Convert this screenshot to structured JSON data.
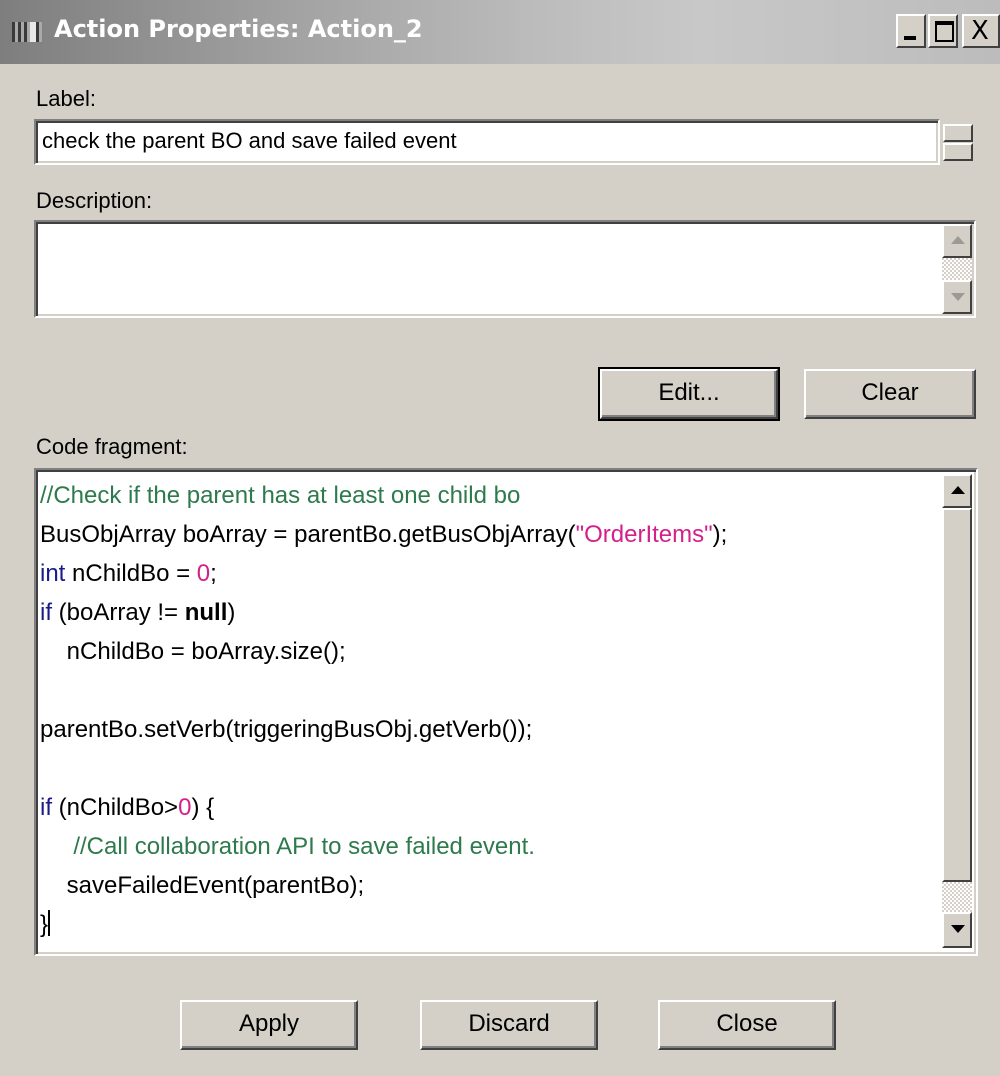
{
  "window": {
    "title": "Action Properties: Action_2",
    "controls": {
      "minimize": "_",
      "maximize": "□",
      "close": "X"
    }
  },
  "label_field": {
    "label": "Label:",
    "value": "check the parent BO and save failed event"
  },
  "description_field": {
    "label": "Description:",
    "value": ""
  },
  "buttons": {
    "edit": "Edit...",
    "clear": "Clear",
    "apply": "Apply",
    "discard": "Discard",
    "close": "Close"
  },
  "code_fragment": {
    "label": "Code fragment:",
    "lines": [
      {
        "indent": "",
        "parts": [
          {
            "t": "cm",
            "v": "//Check if the parent has at least one child bo"
          }
        ]
      },
      {
        "indent": "",
        "parts": [
          {
            "t": "tx",
            "v": "BusObjArray boArray = parentBo.getBusObjArray("
          },
          {
            "t": "str",
            "v": "\"OrderItems\""
          },
          {
            "t": "tx",
            "v": ");"
          }
        ]
      },
      {
        "indent": "",
        "parts": [
          {
            "t": "kw",
            "v": "int"
          },
          {
            "t": "tx",
            "v": " nChildBo = "
          },
          {
            "t": "num",
            "v": "0"
          },
          {
            "t": "tx",
            "v": ";"
          }
        ]
      },
      {
        "indent": "",
        "parts": [
          {
            "t": "kw",
            "v": "if"
          },
          {
            "t": "tx",
            "v": " (boArray != "
          },
          {
            "t": "bold",
            "v": "null"
          },
          {
            "t": "tx",
            "v": ")"
          }
        ]
      },
      {
        "indent": "    ",
        "parts": [
          {
            "t": "tx",
            "v": "nChildBo = boArray.size();"
          }
        ]
      },
      {
        "indent": "",
        "parts": []
      },
      {
        "indent": "",
        "parts": [
          {
            "t": "tx",
            "v": "parentBo.setVerb(triggeringBusObj.getVerb());"
          }
        ]
      },
      {
        "indent": "",
        "parts": []
      },
      {
        "indent": "",
        "parts": [
          {
            "t": "kw",
            "v": "if"
          },
          {
            "t": "tx",
            "v": " (nChildBo>"
          },
          {
            "t": "num",
            "v": "0"
          },
          {
            "t": "tx",
            "v": ") {"
          }
        ]
      },
      {
        "indent": "     ",
        "parts": [
          {
            "t": "cm",
            "v": "//Call collaboration API to save failed event."
          }
        ]
      },
      {
        "indent": "    ",
        "parts": [
          {
            "t": "tx",
            "v": "saveFailedEvent(parentBo);"
          }
        ]
      },
      {
        "indent": "",
        "parts": [
          {
            "t": "tx",
            "v": "}"
          },
          {
            "t": "caret",
            "v": ""
          }
        ]
      }
    ]
  },
  "colors": {
    "keyword": "#1a1a8a",
    "comment": "#2e7a4c",
    "string": "#d4208a",
    "window_bg": "#d4d0c8"
  }
}
